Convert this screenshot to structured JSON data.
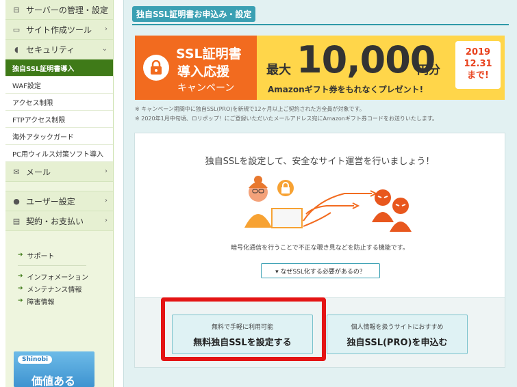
{
  "sidebar": {
    "top_items": [
      {
        "icon": "server-icon",
        "label": "サーバーの管理・設定",
        "chev": "›"
      },
      {
        "icon": "monitor-icon",
        "label": "サイト作成ツール",
        "chev": "›"
      },
      {
        "icon": "shield-icon",
        "label": "セキュリティ",
        "chev": "⌄"
      }
    ],
    "security_sub": [
      "独自SSL証明書導入",
      "WAF設定",
      "アクセス制限",
      "FTPアクセス制限",
      "海外アタックガード",
      "PC用ウィルス対策ソフト導入"
    ],
    "mail": {
      "icon": "mail-icon",
      "label": "メール",
      "chev": "›"
    },
    "user": {
      "icon": "user-icon",
      "label": "ユーザー設定",
      "chev": "›"
    },
    "contract": {
      "icon": "card-icon",
      "label": "契約・お支払い",
      "chev": "›"
    },
    "links_top": [
      "サポート"
    ],
    "links_bottom": [
      "インフォメーション",
      "メンテナンス情報",
      "障害情報"
    ],
    "banner": {
      "logo": "Shinobi",
      "text": "価値ある"
    }
  },
  "main": {
    "title": "独自SSL証明書お申込み・設定",
    "campaign": {
      "line1": "SSL証明書",
      "line2": "導入応援",
      "line3": "キャンペーン",
      "prefix": "最大",
      "amount": "10,000",
      "unit": "円分",
      "sub": "Amazonギフト券をもれなくプレゼント!",
      "date_year": "2019",
      "date_day": "12.31",
      "date_suffix": "まで!"
    },
    "notes": [
      "※ キャンペーン期間中に独自SSL(PRO)を新規で12ヶ月以上ご契約された方全員が対象です。",
      "※ 2020年1月中旬頃、ロリポップ！にご登録いただいたメールアドレス宛にAmazonギフト券コードをお送りいたします。"
    ],
    "panel": {
      "heading": "独自SSLを設定して、安全なサイト運営を行いましょう！",
      "description": "暗号化通信を行うことで不正な覗き見などを防止する機能です。",
      "why_button": "▾ なぜSSL化する必要があるの？",
      "free_option": {
        "sub": "無料で手軽に利用可能",
        "main": "無料独自SSLを設定する"
      },
      "pro_option": {
        "sub": "個人情報を扱うサイトにおすすめ",
        "main": "独自SSL(PRO)を申込む"
      }
    }
  },
  "colors": {
    "sidebar_active": "#3f7a18",
    "accent_teal": "#3aa0b3",
    "campaign_orange": "#f26b1f",
    "campaign_yellow": "#ffd64a",
    "highlight_red": "#e41414"
  }
}
